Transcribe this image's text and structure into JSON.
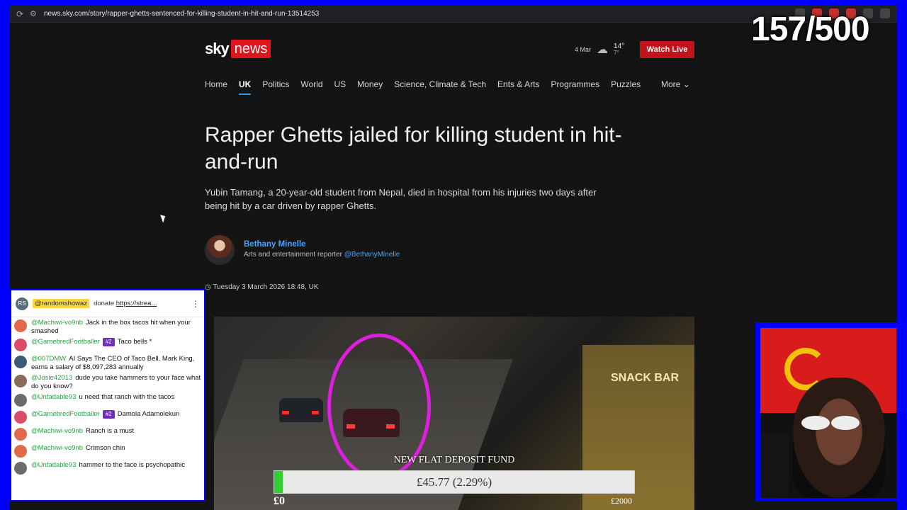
{
  "browser": {
    "url": "news.sky.com/story/rapper-ghetts-sentenced-for-killing-student-in-hit-and-run-13514253"
  },
  "site": {
    "logo_sky": "sky",
    "logo_news": "news",
    "weather": {
      "date": "4 Mar",
      "high": "14°",
      "low": "7°"
    },
    "watch_live": "Watch Live",
    "nav": [
      "Home",
      "UK",
      "Politics",
      "World",
      "US",
      "Money",
      "Science, Climate & Tech",
      "Ents & Arts",
      "Programmes",
      "Puzzles"
    ],
    "more": "More",
    "active_nav": "UK"
  },
  "article": {
    "headline": "Rapper Ghetts jailed for killing student in hit-and-run",
    "standfirst": "Yubin Tamang, a 20-year-old student from Nepal, died in hospital from his injuries two days after being hit by a car driven by rapper Ghetts.",
    "author_name": "Bethany Minelle",
    "author_role": "Arts and entertainment reporter",
    "author_handle": "@BethanyMinelle",
    "pubdate": "Tuesday 3 March 2026 18:48, UK",
    "image_sign": "SNACK BAR"
  },
  "overlay": {
    "counter": "157/500"
  },
  "chat": {
    "pinned": {
      "avatar": "RS",
      "user": "@randomshowaz",
      "text": "donate",
      "link": "https://strea..."
    },
    "messages": [
      {
        "user": "@Machiwi-vo9nb",
        "text": "Jack in the box tacos hit when your smashed",
        "avatar_color": "#e06a4a"
      },
      {
        "user": "@GamebredFootballer",
        "badge": "#2",
        "text": "Taco bells *",
        "avatar_color": "#d94c6a"
      },
      {
        "user": "@007DMW",
        "text": "AI Says The CEO of Taco Bell, Mark King, earns a salary of $8,097,283 annually",
        "avatar_color": "#3c5b7a"
      },
      {
        "user": "@Josie42013",
        "text": "dude you take hammers to your face what do you know?",
        "avatar_color": "#8a6a5a"
      },
      {
        "user": "@Unfadable93",
        "text": "u need that ranch with the tacos",
        "avatar_color": "#6b6b6b"
      },
      {
        "user": "@GamebredFootballer",
        "badge": "#2",
        "text": "Damola Adamolekun",
        "avatar_color": "#d94c6a"
      },
      {
        "user": "@Machiwi-vo9nb",
        "text": "Ranch is a must",
        "avatar_color": "#e06a4a"
      },
      {
        "user": "@Machiwi-vo9nb",
        "text": "Crimson chin",
        "avatar_color": "#e06a4a"
      },
      {
        "user": "@Unfadable93",
        "text": "hammer to the face is psychopathic",
        "avatar_color": "#6b6b6b"
      }
    ]
  },
  "donation": {
    "title": "NEW FLAT DEPOSIT FUND",
    "amount_text": "£45.77 (2.29%)",
    "progress_percent": 2.29,
    "min_label": "£0",
    "max_label": "£2000",
    "fill_color": "#2fd02f"
  }
}
